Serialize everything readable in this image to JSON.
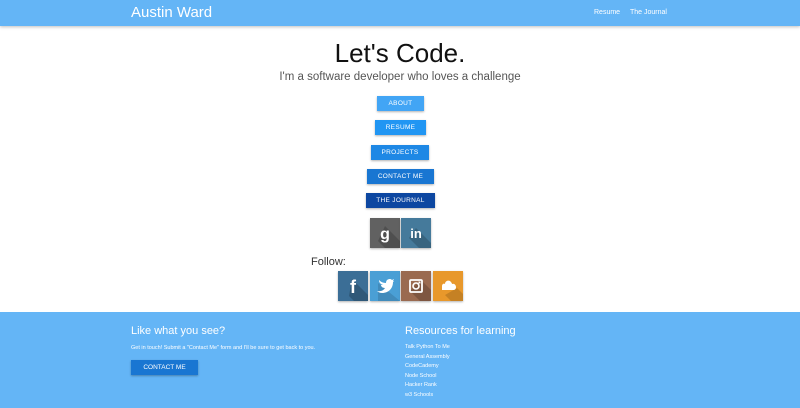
{
  "nav": {
    "brand": "Austin Ward",
    "links": [
      "Resume",
      "The Journal"
    ]
  },
  "hero": {
    "title": "Let's Code.",
    "subtitle": "I'm a software developer who loves a challenge"
  },
  "buttons": [
    {
      "label": "ABOUT",
      "color": "#42a5f5"
    },
    {
      "label": "RESUME",
      "color": "#2196f3"
    },
    {
      "label": "PROJECTS",
      "color": "#1e88e5"
    },
    {
      "label": "CONTACT ME",
      "color": "#1976d2"
    },
    {
      "label": "THE JOURNAL",
      "color": "#0d47a1"
    }
  ],
  "profiles": [
    {
      "icon": "goodreads-icon",
      "color": "#616161"
    },
    {
      "icon": "linkedin-icon",
      "color": "#457a9b"
    }
  ],
  "follow": {
    "label": "Follow:",
    "icons": [
      {
        "icon": "facebook-icon",
        "color": "#3b6e96"
      },
      {
        "icon": "twitter-icon",
        "color": "#4a9fd5"
      },
      {
        "icon": "instagram-icon",
        "color": "#9a6a50"
      },
      {
        "icon": "soundcloud-icon",
        "color": "#e8982b"
      }
    ]
  },
  "footer": {
    "left_heading": "Like what you see?",
    "left_text": "Get in touch! Submit a \"Contact Me\" form and I'll be sure to get back to you.",
    "contact_button": "CONTACT ME",
    "right_heading": "Resources for learning",
    "resources": [
      "Talk Python To Me",
      "General Assembly",
      "CodeCademy",
      "Node School",
      "Hacker Rank",
      "w3 Schools"
    ]
  }
}
